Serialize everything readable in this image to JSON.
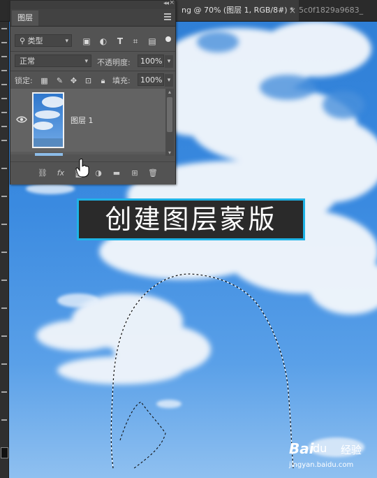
{
  "tabs": {
    "active": {
      "label": "ng @ 70% (图层 1, RGB/8#) *",
      "close": "×"
    },
    "second": {
      "label": "5c0f1829a9683_"
    }
  },
  "layers_panel": {
    "title": "图层",
    "filter": {
      "kind": "类型"
    },
    "filter_icons": [
      "image-filter-icon",
      "adjustment-filter-icon",
      "type-filter-icon",
      "shape-filter-icon",
      "smart-object-filter-icon"
    ],
    "blend_mode": "正常",
    "opacity_label": "不透明度:",
    "opacity_value": "100%",
    "lock_label": "锁定:",
    "lock_icons": [
      "lock-transparent-icon",
      "lock-image-icon",
      "lock-position-icon",
      "lock-artboard-icon",
      "lock-all-icon"
    ],
    "fill_label": "填充:",
    "fill_value": "100%",
    "layers": [
      {
        "name": "图层 1",
        "visible": true
      }
    ],
    "footer_icons": [
      "link-layers-icon",
      "fx-icon",
      "add-mask-icon",
      "adjustment-layer-icon",
      "group-folder-icon",
      "new-layer-icon",
      "delete-icon"
    ],
    "footer_fx": "fx"
  },
  "caption": "创建图层蒙版",
  "watermark": {
    "brand": "Bai",
    "paw": "du",
    "jingyan": "经验",
    "url": "jingyan.baidu.com"
  },
  "colors": {
    "caption_border": "#1fb3e6",
    "panel_bg": "#535353",
    "sky": "#3a8ae0"
  }
}
